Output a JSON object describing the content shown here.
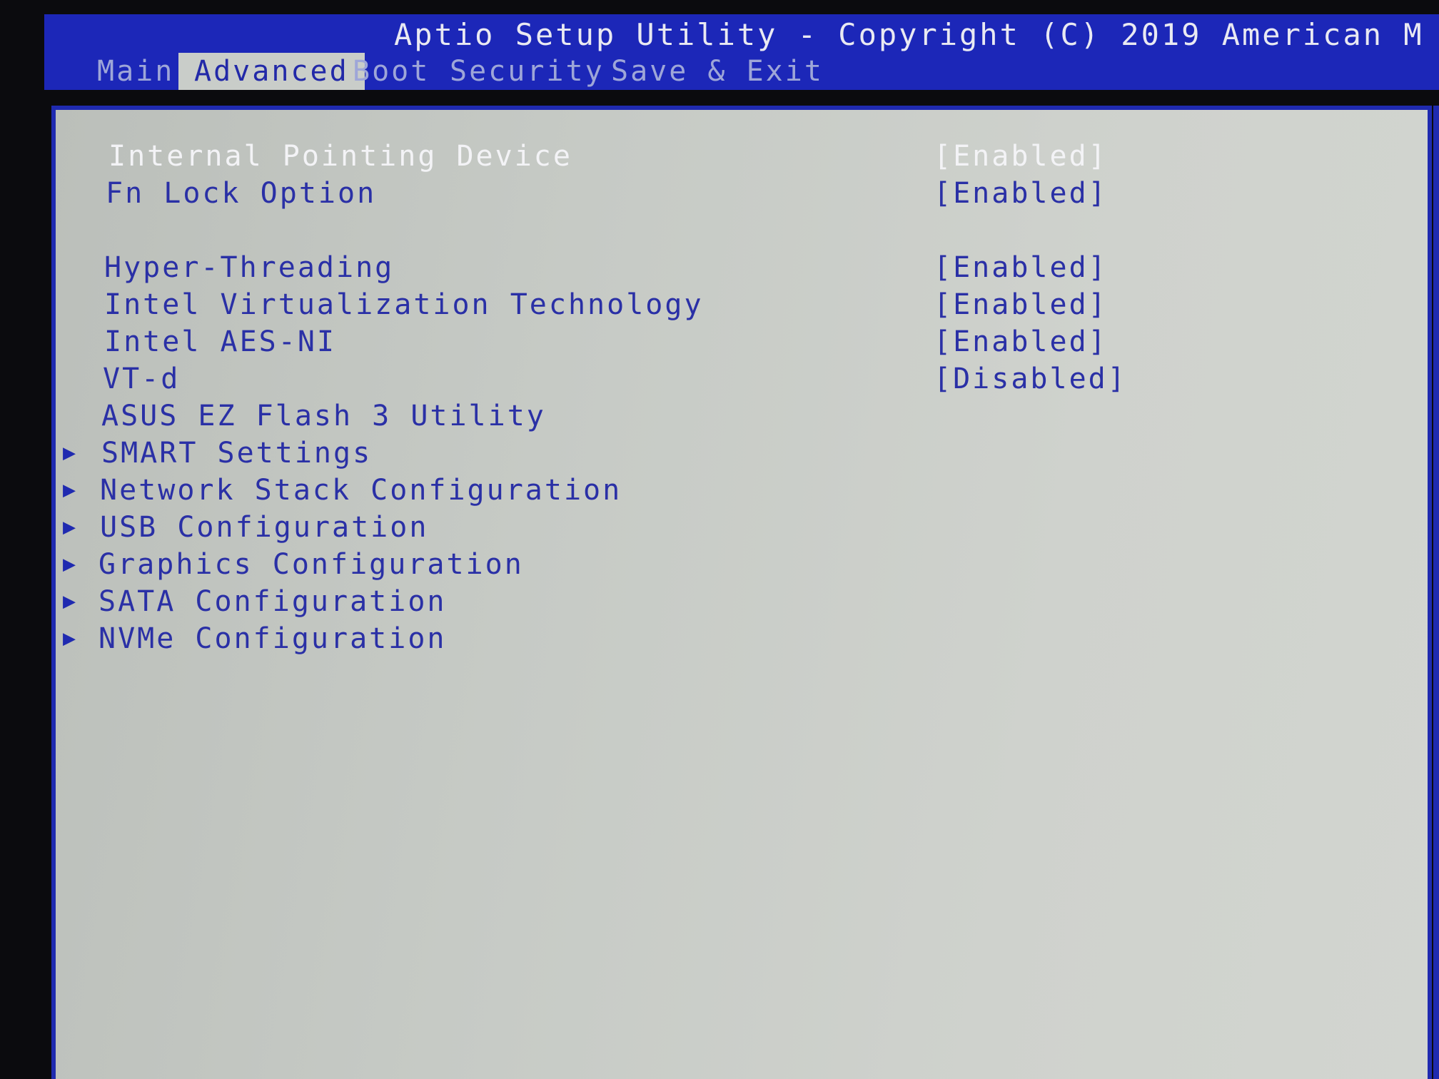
{
  "header": {
    "title": "Aptio Setup Utility - Copyright (C) 2019 American M",
    "tabs": [
      {
        "label": "Main"
      },
      {
        "label": "Advanced"
      },
      {
        "label": "Boot"
      },
      {
        "label": "Security"
      },
      {
        "label": "Save & Exit"
      }
    ],
    "active_tab": "Advanced"
  },
  "settings": [
    {
      "label": "Internal Pointing Device",
      "value": "[Enabled]"
    },
    {
      "label": "Fn Lock Option",
      "value": "[Enabled]"
    },
    {
      "label": "Hyper-Threading",
      "value": "[Enabled]"
    },
    {
      "label": "Intel Virtualization Technology",
      "value": "[Enabled]"
    },
    {
      "label": "Intel AES-NI",
      "value": "[Enabled]"
    },
    {
      "label": "VT-d",
      "value": "[Disabled]"
    },
    {
      "label": "ASUS EZ Flash 3 Utility"
    }
  ],
  "submenus": [
    {
      "label": "SMART Settings",
      "icon": "right-triangle-icon"
    },
    {
      "label": "Network Stack Configuration",
      "icon": "right-triangle-icon"
    },
    {
      "label": "USB Configuration",
      "icon": "right-triangle-icon"
    },
    {
      "label": "Graphics Configuration",
      "icon": "right-triangle-icon"
    },
    {
      "label": "SATA Configuration",
      "icon": "right-triangle-icon"
    },
    {
      "label": "NVMe Configuration",
      "icon": "right-triangle-icon"
    }
  ],
  "arrow_glyph": "▶",
  "colors": {
    "header_blue": "#1c27b8",
    "text_blue": "#2a30a6",
    "selected_text": "#f3f3f6",
    "panel_gray": "#c6cac5"
  }
}
